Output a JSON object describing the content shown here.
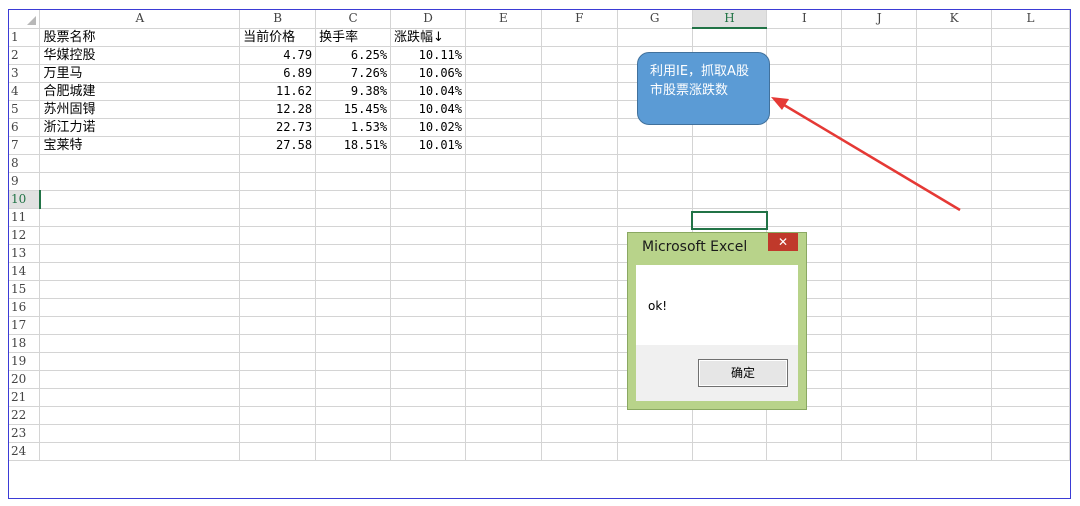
{
  "columns": [
    "A",
    "B",
    "C",
    "D",
    "E",
    "F",
    "G",
    "H",
    "I",
    "J",
    "K",
    "L"
  ],
  "selected_column": "H",
  "selected_row": 10,
  "row_count": 24,
  "header_row": [
    "股票名称",
    "当前价格",
    "换手率",
    "涨跌幅↓"
  ],
  "rows": [
    [
      "华媒控股",
      "4.79",
      "6.25%",
      "10.11%"
    ],
    [
      "万里马",
      "6.89",
      "7.26%",
      "10.06%"
    ],
    [
      "合肥城建",
      "11.62",
      "9.38%",
      "10.04%"
    ],
    [
      "苏州固锝",
      "12.28",
      "15.45%",
      "10.04%"
    ],
    [
      "浙江力诺",
      "22.73",
      "1.53%",
      "10.02%"
    ],
    [
      "宝莱特",
      "27.58",
      "18.51%",
      "10.01%"
    ]
  ],
  "callout": {
    "text": "利用IE，抓取A股市股票涨跌数",
    "color": "#5b9bd5"
  },
  "dialog": {
    "title": "Microsoft Excel",
    "message": "ok!",
    "button": "确定",
    "close": "✕"
  },
  "colors": {
    "frame": "#3b3bd6",
    "selection": "#217346",
    "arrow": "#e53935"
  }
}
